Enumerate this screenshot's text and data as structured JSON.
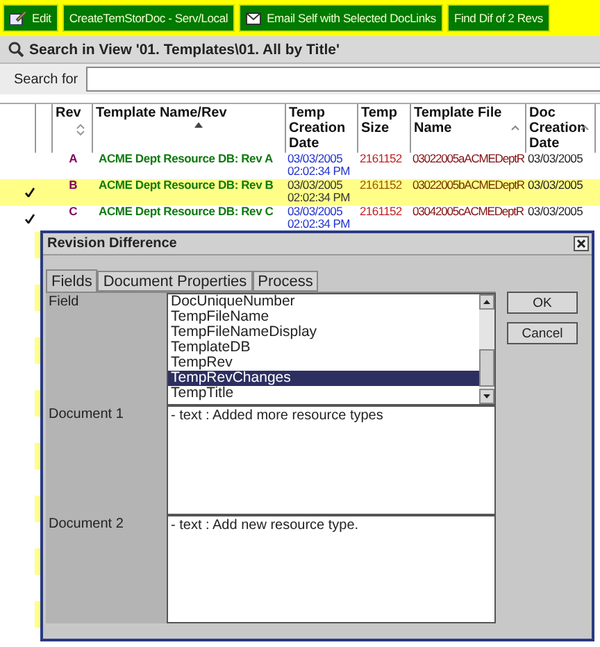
{
  "toolbar": [
    {
      "label": "Edit"
    },
    {
      "label": "CreateTemStorDoc - Serv/Local"
    },
    {
      "label": "Email Self with Selected DocLinks"
    },
    {
      "label": "Find Dif of 2 Revs"
    }
  ],
  "search": {
    "title": "Search in View '01. Templates\\01. All by Title'",
    "label": "Search for"
  },
  "table": {
    "columns": [
      {
        "label": "Rev"
      },
      {
        "label": "Template Name/Rev"
      },
      {
        "label": "Temp Creation Date"
      },
      {
        "label": "Temp Size"
      },
      {
        "label": "Template File Name"
      },
      {
        "label": "Doc Creation Date"
      }
    ],
    "rows": [
      {
        "checked": false,
        "highlighted": false,
        "rev": "A",
        "name": "ACME Dept Resource DB: Rev A",
        "date": "03/03/2005",
        "time": "02:02:34 PM",
        "size": "2161152",
        "file": "03022005aACMEDeptR",
        "doc_date": "03/03/2005"
      },
      {
        "checked": true,
        "highlighted": true,
        "rev": "B",
        "name": "ACME Dept Resource DB: Rev B",
        "date": "03/03/2005",
        "time": "02:02:34 PM",
        "size": "2161152",
        "file": "03022005bACMEDeptR",
        "doc_date": "03/03/2005"
      },
      {
        "checked": true,
        "highlighted": false,
        "rev": "C",
        "name": "ACME Dept Resource DB: Rev C",
        "date": "03/03/2005",
        "time": "02:02:34 PM",
        "size": "2161152",
        "file": "03042005cACMEDeptR",
        "doc_date": "03/03/2005"
      }
    ]
  },
  "dialog": {
    "title": "Revision Difference",
    "tabs": [
      {
        "label": "Fields",
        "selected": true
      },
      {
        "label": "Document Properties",
        "selected": false
      },
      {
        "label": "Process",
        "selected": false
      }
    ],
    "field_label": "Field",
    "fields": [
      {
        "label": "DocUniqueNumber",
        "selected": false
      },
      {
        "label": "TempFileName",
        "selected": false
      },
      {
        "label": "TempFileNameDisplay",
        "selected": false
      },
      {
        "label": "TemplateDB",
        "selected": false
      },
      {
        "label": "TempRev",
        "selected": false
      },
      {
        "label": "TempRevChanges",
        "selected": true
      },
      {
        "label": "TempTitle",
        "selected": false
      }
    ],
    "documents": [
      {
        "label": "Document 1",
        "value": "- text : Added more resource types"
      },
      {
        "label": "Document 2",
        "value": "- text : Add new resource type."
      }
    ],
    "buttons": [
      "OK",
      "Cancel"
    ]
  }
}
